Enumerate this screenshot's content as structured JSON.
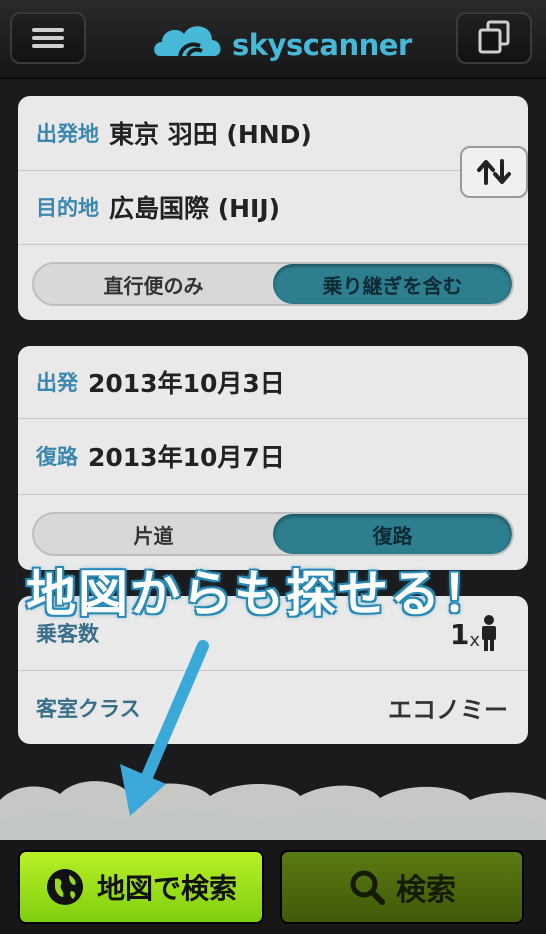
{
  "header": {
    "logo_text": "skyscanner",
    "menu_icon": "hamburger-menu-icon",
    "copy_icon": "copy-icon",
    "brand_color": "#46b8d8"
  },
  "route": {
    "origin_label": "出発地",
    "origin_value": "東京 羽田 (HND)",
    "destination_label": "目的地",
    "destination_value": "広島国際 (HIJ)",
    "swap_icon": "swap-arrows-icon",
    "stops_options": [
      "直行便のみ",
      "乗り継ぎを含む"
    ],
    "stops_selected": "乗り継ぎを含む"
  },
  "dates": {
    "depart_label": "出発",
    "depart_value": "2013年10月3日",
    "return_label": "復路",
    "return_value": "2013年10月7日",
    "trip_options": [
      "片道",
      "復路"
    ],
    "trip_selected": "復路"
  },
  "passengers": {
    "label": "乗客数",
    "count": "1",
    "multiplier": "x",
    "icon": "person-icon",
    "cabin_label": "客室クラス",
    "cabin_value": "エコノミー"
  },
  "overlay": {
    "banner_text": "地図からも探せる！",
    "arrow_icon": "arrow-down-left-icon",
    "accent": "#3aa8d8"
  },
  "bottom": {
    "map_search_label": "地図で検索",
    "map_icon": "globe-icon",
    "search_label": "検索",
    "search_icon": "search-icon"
  }
}
